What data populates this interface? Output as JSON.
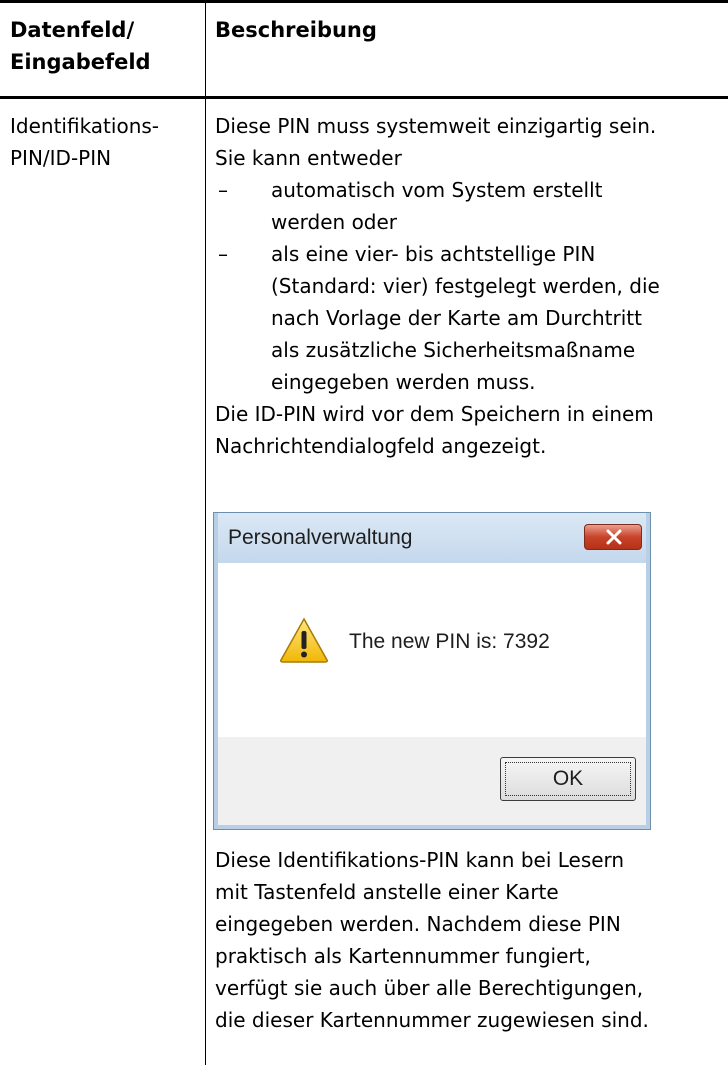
{
  "table": {
    "headers": {
      "col1_line1": "Datenfeld/",
      "col1_line2": "Eingabefeld",
      "col2": "Beschreibung"
    },
    "row": {
      "label_line1": "Identifikations-",
      "label_line2": "PIN/ID-PIN",
      "intro_line1": "Diese PIN muss systemweit einzigartig sein.",
      "intro_line2": "Sie kann entweder",
      "bullets": [
        {
          "dash": "–",
          "lines": [
            "automatisch vom System erstellt",
            "werden oder"
          ]
        },
        {
          "dash": "–",
          "lines": [
            "als eine vier- bis achtstellige PIN",
            "(Standard: vier) festgelegt werden, die",
            "nach Vorlage der Karte am Durchtritt",
            "als zusätzliche Sicherheitsmaßname",
            "eingegeben werden muss."
          ]
        }
      ],
      "after_bullets_line1": "Die ID-PIN wird vor dem Speichern in einem",
      "after_bullets_line2": "Nachrichtendialogfeld angezeigt.",
      "closing_lines": [
        "Diese Identifikations-PIN kann bei Lesern",
        "mit Tastenfeld anstelle einer Karte",
        "eingegeben werden. Nachdem diese PIN",
        "praktisch als Kartennummer fungiert,",
        "verfügt sie auch über alle Berechtigungen,",
        "die dieser Kartennummer zugewiesen sind."
      ]
    }
  },
  "dialog": {
    "title": "Personalverwaltung",
    "message": "The new PIN is: 7392",
    "ok_label": "OK",
    "icons": {
      "warning": "warning-icon",
      "close": "close-icon"
    },
    "colors": {
      "close_button": "#c8432a",
      "warning_fill": "#f5c518"
    }
  }
}
